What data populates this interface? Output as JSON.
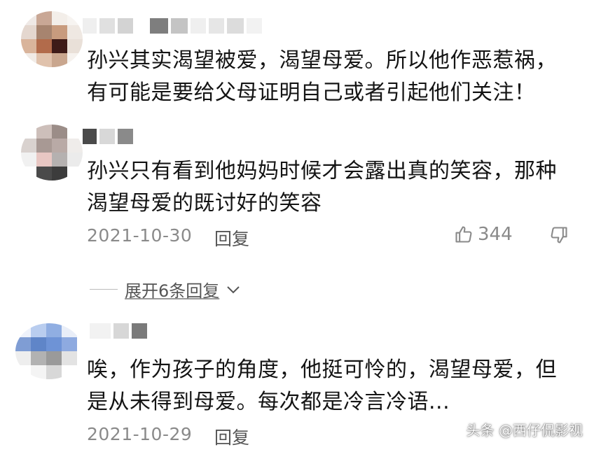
{
  "comments": [
    {
      "text_line1": "孙兴其实渴望被爱，渴望母爱。所以他作恶惹祸，",
      "text_line2": "有可能是要给父母证明自己或者引起他们关注！"
    },
    {
      "text_line1": "孙兴只有看到他妈妈时候才会露出真的笑容，那种",
      "text_line2": "渴望母爱的既讨好的笑容",
      "date": "2021-10-30",
      "reply_label": "回复",
      "likes": "344",
      "expand_label": "展开6条回复"
    },
    {
      "text_line1": "唉，作为孩子的角度，他挺可怜的，渴望母爱，但",
      "text_line2": "是从未得到母爱。每次都是冷言冷语...",
      "date": "2021-10-29",
      "reply_label": "回复"
    }
  ],
  "watermark": "头条 @西仔侃影视",
  "colors": {
    "text": "#141414",
    "meta": "#8a8a8a",
    "background": "#ffffff"
  },
  "icons": [
    "thumbs-up-icon",
    "thumbs-down-icon",
    "chevron-down-icon"
  ]
}
